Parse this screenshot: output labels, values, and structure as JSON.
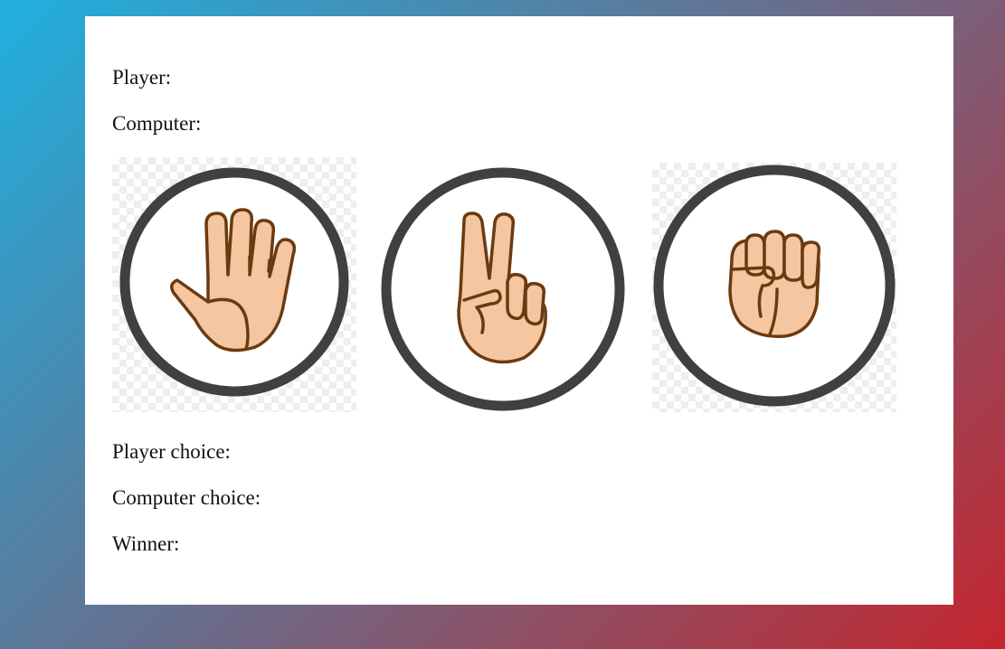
{
  "labels": {
    "player": "Player:",
    "computer": "Computer:",
    "player_choice": "Player choice:",
    "computer_choice": "Computer choice:",
    "winner": "Winner:"
  },
  "choices": [
    {
      "name": "paper",
      "icon": "open-hand-icon"
    },
    {
      "name": "scissors",
      "icon": "victory-hand-icon"
    },
    {
      "name": "rock",
      "icon": "fist-icon"
    }
  ],
  "colors": {
    "skin": "#f5c6a0",
    "outline": "#6b3a10",
    "ring": "#404040",
    "card": "#ffffff"
  }
}
